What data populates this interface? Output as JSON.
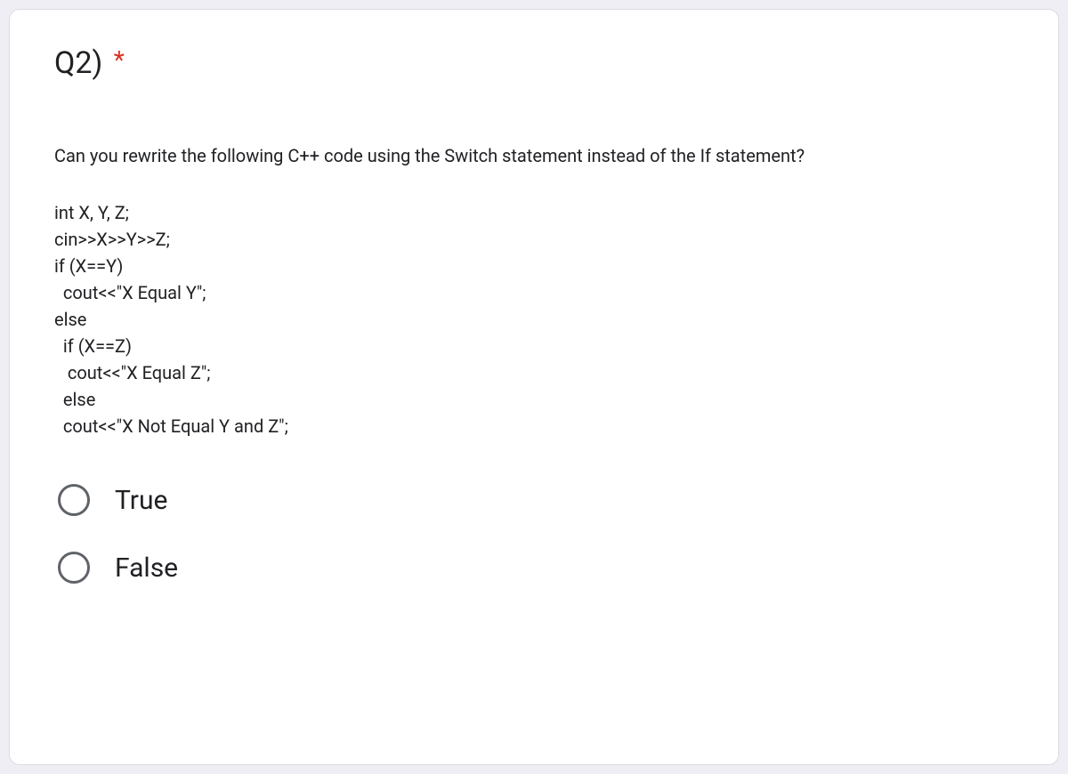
{
  "question": {
    "title": "Q2)",
    "required_marker": "*",
    "prompt": "Can you rewrite the following C++ code using the Switch statement instead of the If statement?",
    "code_lines": [
      "int X, Y, Z;",
      "cin>>X>>Y>>Z;",
      "if (X==Y)",
      "  cout<<\"X Equal Y\";",
      "else",
      "  if (X==Z)",
      "   cout<<\"X Equal Z\";",
      "  else",
      "  cout<<\"X Not Equal Y and Z\";"
    ],
    "options": [
      {
        "label": "True"
      },
      {
        "label": "False"
      }
    ]
  }
}
